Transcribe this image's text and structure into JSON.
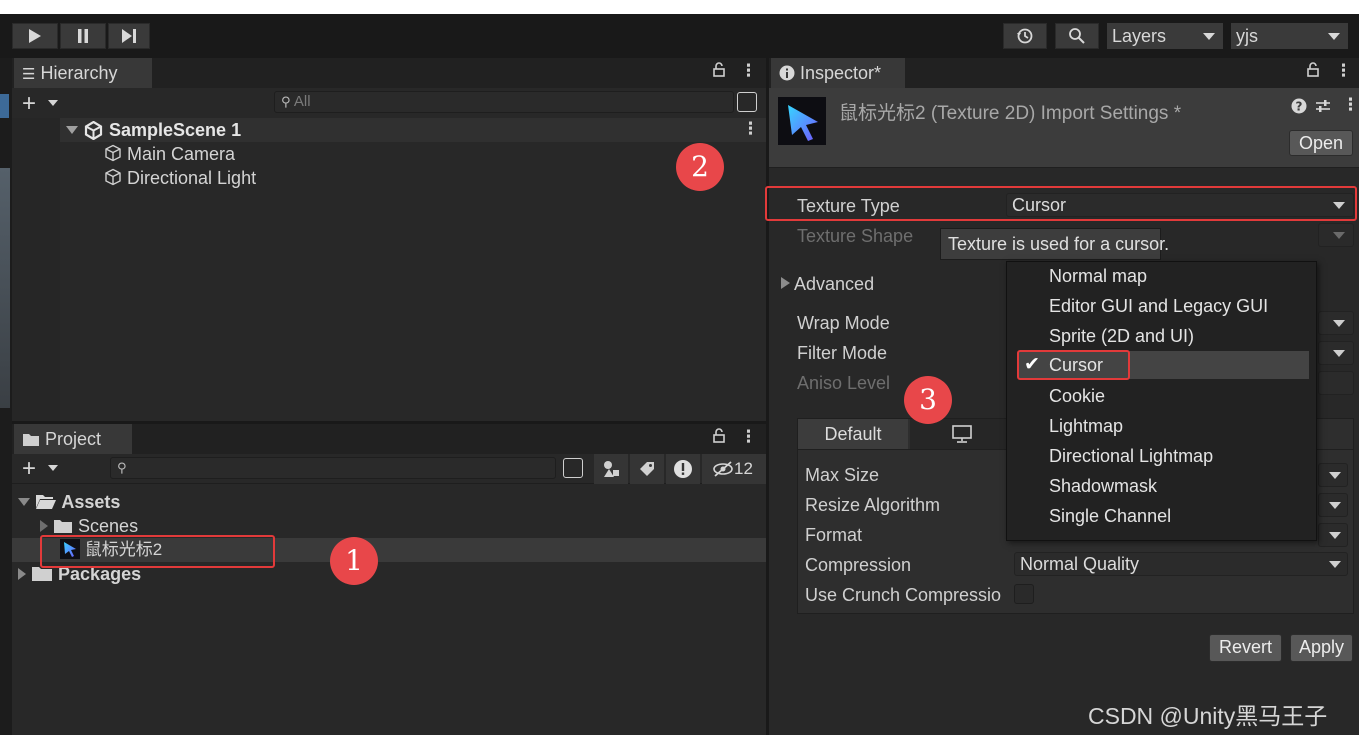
{
  "toolbar": {
    "layers_label": "Layers",
    "account_label": "yjs"
  },
  "hierarchy": {
    "tab_label": "Hierarchy",
    "search_placeholder": "All",
    "scene_name": "SampleScene 1",
    "items": [
      "Main Camera",
      "Directional Light"
    ]
  },
  "project": {
    "tab_label": "Project",
    "hidden_count": "12",
    "tree": {
      "assets": "Assets",
      "scenes": "Scenes",
      "asset_file": "鼠标光标2",
      "packages": "Packages"
    }
  },
  "inspector": {
    "tab_label": "Inspector*",
    "header_title": "鼠标光标2 (Texture 2D) Import Settings *",
    "open_button": "Open",
    "texture_type_label": "Texture Type",
    "texture_type_value": "Cursor",
    "texture_shape_label": "Texture Shape",
    "tooltip": "Texture is used for a cursor.",
    "advanced_label": "Advanced",
    "wrap_mode_label": "Wrap Mode",
    "filter_mode_label": "Filter Mode",
    "aniso_level_label": "Aniso Level",
    "platform_tab_default": "Default",
    "max_size_label": "Max Size",
    "resize_algorithm_label": "Resize Algorithm",
    "format_label": "Format",
    "compression_label": "Compression",
    "compression_value": "Normal Quality",
    "crunch_label": "Use Crunch Compressio",
    "revert_button": "Revert",
    "apply_button": "Apply"
  },
  "dropdown": {
    "items": [
      "Normal map",
      "Editor GUI and Legacy GUI",
      "Sprite (2D and UI)",
      "Cursor",
      "Cookie",
      "Lightmap",
      "Directional Lightmap",
      "Shadowmask",
      "Single Channel"
    ],
    "selected": "Cursor"
  },
  "annotations": {
    "marker_1": "1",
    "marker_2": "2",
    "marker_3": "3",
    "highlight_color": "#e23a3a"
  },
  "watermark": "CSDN @Unity黑马王子"
}
